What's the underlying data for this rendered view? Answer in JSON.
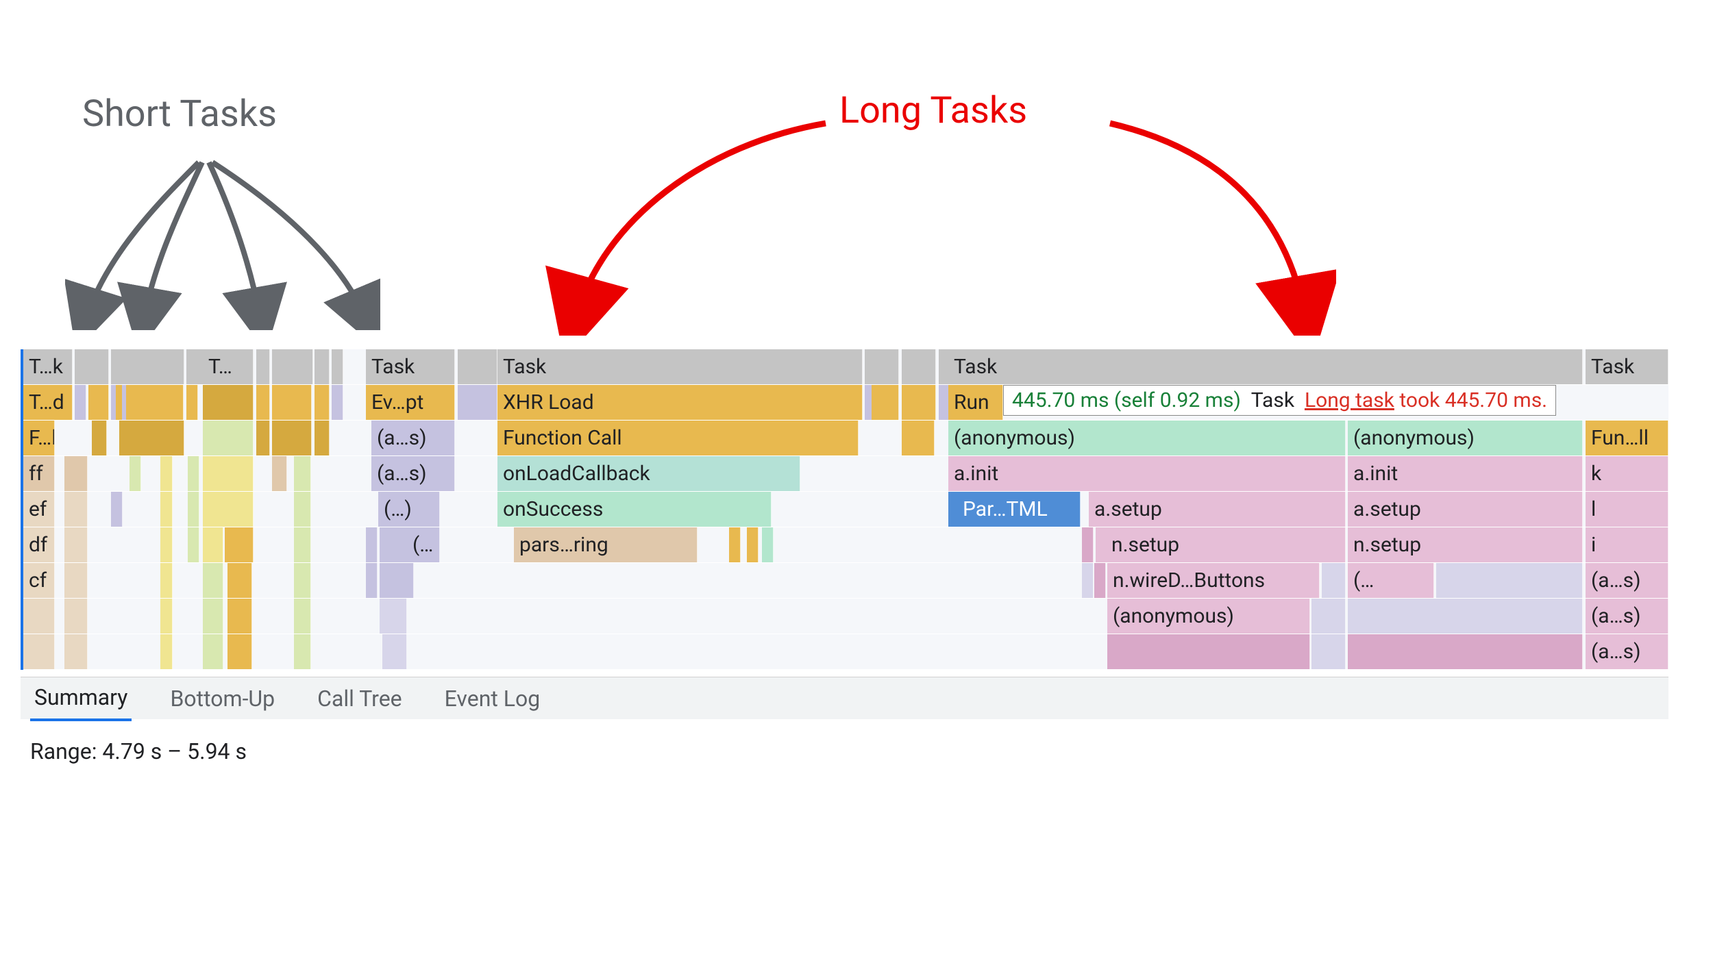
{
  "annotations": {
    "short": "Short Tasks",
    "long": "Long Tasks"
  },
  "tooltip": {
    "time": "445.70 ms (self 0.92 ms)",
    "type": "Task",
    "link": "Long task",
    "took": "took 445.70 ms."
  },
  "flame": {
    "row0": {
      "t1": "T…k",
      "t2": "T…",
      "t3": "Task",
      "t4": "Task",
      "t5": "Task",
      "t6": "Task"
    },
    "row1": {
      "a": "T…d",
      "b": "Ev…pt",
      "c": "XHR Load",
      "d": "Run"
    },
    "row2": {
      "a": "F…l",
      "b": "(a…s)",
      "c": "Function Call",
      "d": "(anonymous)",
      "e": "(anonymous)",
      "f": "Fun…ll"
    },
    "row3": {
      "a": "ff",
      "b": "(a…s)",
      "c": "onLoadCallback",
      "d": "a.init",
      "e": "a.init",
      "f": "k"
    },
    "row4": {
      "a": "ef",
      "b": "(…)",
      "c": "onSuccess",
      "d": "Par…TML",
      "e": "a.setup",
      "f": "a.setup",
      "g": "l"
    },
    "row5": {
      "a": "df",
      "b": "(…",
      "c": "pars…ring",
      "d": "n.setup",
      "e": "n.setup",
      "f": "i"
    },
    "row6": {
      "a": "cf",
      "b": "n.wireD…Buttons",
      "c": "(…",
      "d": "(a…s)"
    },
    "row7": {
      "a": "(anonymous)",
      "b": "(a…s)"
    },
    "row8": {
      "a": "(a…s)"
    }
  },
  "tabs": {
    "summary": "Summary",
    "bottomup": "Bottom-Up",
    "calltree": "Call Tree",
    "eventlog": "Event Log"
  },
  "range": "Range:  4.79 s – 5.94 s"
}
